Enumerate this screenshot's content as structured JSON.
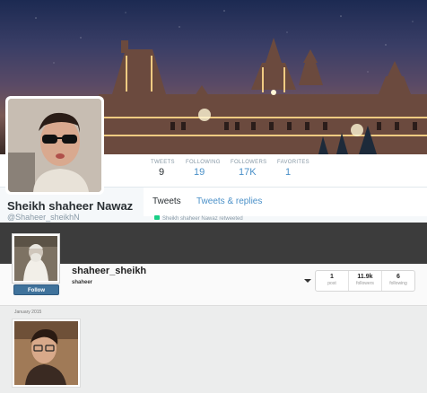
{
  "twitter": {
    "name": "Sheikh shaheer Nawaz",
    "handle": "@Shaheer_sheikhN",
    "stats": [
      {
        "label": "TWEETS",
        "value": "9"
      },
      {
        "label": "FOLLOWING",
        "value": "19"
      },
      {
        "label": "FOLLOWERS",
        "value": "17K"
      },
      {
        "label": "FAVORITES",
        "value": "1"
      }
    ],
    "tabs": [
      "Tweets",
      "Tweets & replies"
    ],
    "retweet_text": "Sheikh shaheer Nawaz retweeted",
    "colors": {
      "accent": "#55acee",
      "link": "#4a90c8",
      "retweet": "#19cf86"
    }
  },
  "instagram": {
    "username": "shaheer_sheikh",
    "full_name": "shaheer",
    "follow_label": "Follow",
    "stats": [
      {
        "value": "1",
        "label": "post"
      },
      {
        "value": "11.9k",
        "label": "followers"
      },
      {
        "value": "6",
        "label": "following"
      }
    ],
    "month_label": "January 2015",
    "colors": {
      "follow_button": "#3f729b",
      "header": "#3c3c3c"
    }
  }
}
